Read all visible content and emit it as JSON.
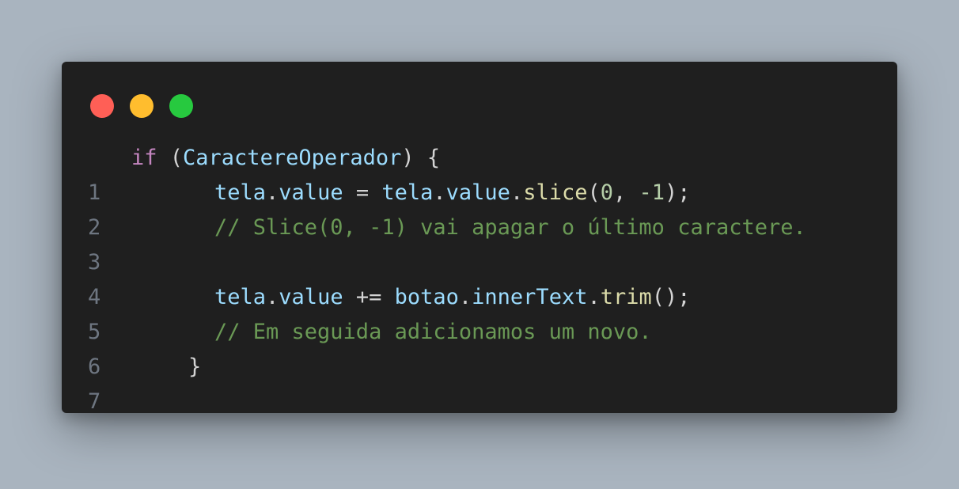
{
  "window": {
    "controls": [
      {
        "name": "close",
        "color": "#ff5f56"
      },
      {
        "name": "minimize",
        "color": "#ffbd2e"
      },
      {
        "name": "maximize",
        "color": "#27c93f"
      }
    ]
  },
  "code": {
    "language": "javascript",
    "lines": [
      {
        "number": "1",
        "tokens": [
          {
            "text": "if",
            "kind": "kw"
          },
          {
            "text": " (",
            "kind": "pl"
          },
          {
            "text": "CaractereOperador",
            "kind": "var"
          },
          {
            "text": ") {",
            "kind": "pl"
          }
        ]
      },
      {
        "number": "2",
        "tokens": [
          {
            "text": "tela",
            "kind": "var"
          },
          {
            "text": ".",
            "kind": "pl"
          },
          {
            "text": "value",
            "kind": "var"
          },
          {
            "text": " = ",
            "kind": "pl"
          },
          {
            "text": "tela",
            "kind": "var"
          },
          {
            "text": ".",
            "kind": "pl"
          },
          {
            "text": "value",
            "kind": "var"
          },
          {
            "text": ".",
            "kind": "pl"
          },
          {
            "text": "slice",
            "kind": "fn"
          },
          {
            "text": "(",
            "kind": "pl"
          },
          {
            "text": "0",
            "kind": "num"
          },
          {
            "text": ", ",
            "kind": "pl"
          },
          {
            "text": "-1",
            "kind": "num"
          },
          {
            "text": ");",
            "kind": "pl"
          }
        ]
      },
      {
        "number": "3",
        "tokens": [
          {
            "text": "// Slice(0, -1) vai apagar o último caractere.",
            "kind": "cm"
          }
        ]
      },
      {
        "number": "4",
        "tokens": []
      },
      {
        "number": "5",
        "tokens": [
          {
            "text": "tela",
            "kind": "var"
          },
          {
            "text": ".",
            "kind": "pl"
          },
          {
            "text": "value",
            "kind": "var"
          },
          {
            "text": " += ",
            "kind": "pl"
          },
          {
            "text": "botao",
            "kind": "var"
          },
          {
            "text": ".",
            "kind": "pl"
          },
          {
            "text": "innerText",
            "kind": "var"
          },
          {
            "text": ".",
            "kind": "pl"
          },
          {
            "text": "trim",
            "kind": "fn"
          },
          {
            "text": "();",
            "kind": "pl"
          }
        ]
      },
      {
        "number": "6",
        "tokens": [
          {
            "text": "// Em seguida adicionamos um novo.",
            "kind": "cm"
          }
        ]
      },
      {
        "number": "7",
        "tokens": [
          {
            "text": "}",
            "kind": "pl"
          }
        ]
      }
    ]
  }
}
